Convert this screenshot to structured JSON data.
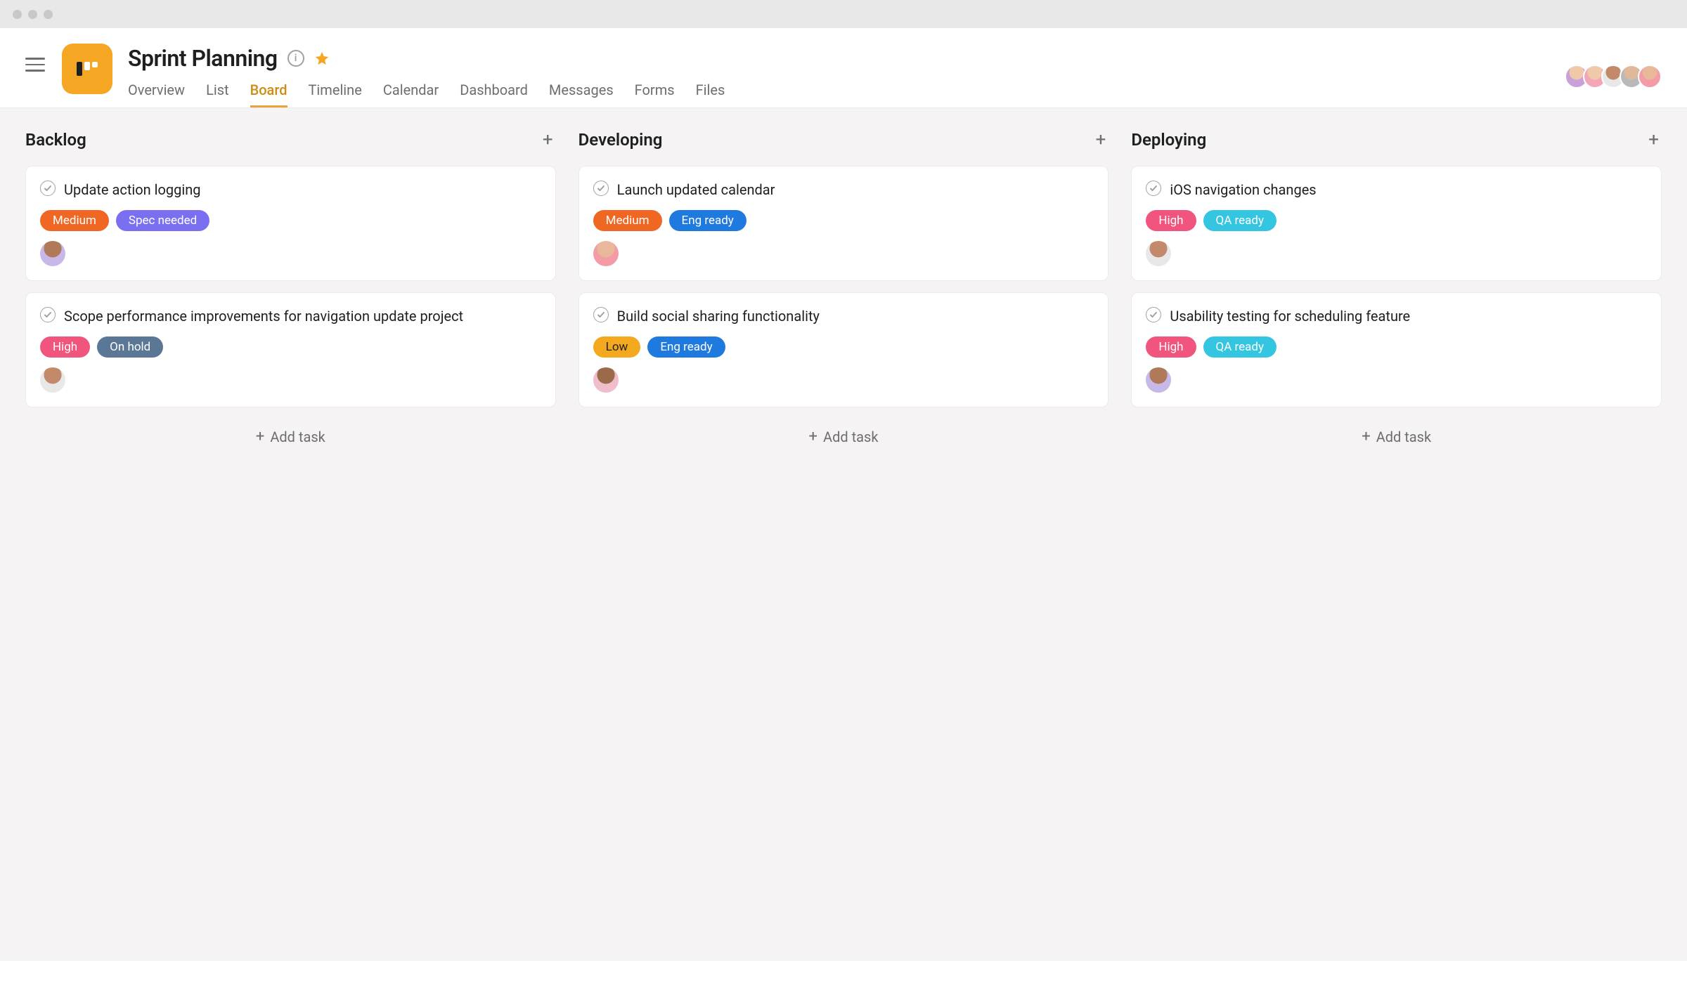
{
  "project": {
    "title": "Sprint Planning",
    "starred": true
  },
  "tabs": [
    {
      "label": "Overview",
      "active": false
    },
    {
      "label": "List",
      "active": false
    },
    {
      "label": "Board",
      "active": true
    },
    {
      "label": "Timeline",
      "active": false
    },
    {
      "label": "Calendar",
      "active": false
    },
    {
      "label": "Dashboard",
      "active": false
    },
    {
      "label": "Messages",
      "active": false
    },
    {
      "label": "Forms",
      "active": false
    },
    {
      "label": "Files",
      "active": false
    }
  ],
  "header_avatars": [
    "av-1",
    "av-5",
    "av-6",
    "av-4",
    "av-2"
  ],
  "tag_colors": {
    "High": "#f1547c",
    "Medium": "#ef6722",
    "Low": "#f4a81d",
    "Spec needed": "#7a6ff0",
    "Eng ready": "#1f7ae0",
    "On hold": "#5a7896",
    "QA ready": "#34c5e0"
  },
  "add_task_label": "Add task",
  "columns": [
    {
      "title": "Backlog",
      "cards": [
        {
          "title": "Update action logging",
          "tags": [
            "Medium",
            "Spec needed"
          ],
          "assignee": "av-7"
        },
        {
          "title": "Scope performance improvements for navigation update project",
          "tags": [
            "High",
            "On hold"
          ],
          "assignee": "av-6"
        }
      ]
    },
    {
      "title": "Developing",
      "cards": [
        {
          "title": "Launch updated calendar",
          "tags": [
            "Medium",
            "Eng ready"
          ],
          "assignee": "av-2"
        },
        {
          "title": "Build social sharing functionality",
          "tags": [
            "Low",
            "Eng ready"
          ],
          "assignee": "av-8"
        }
      ]
    },
    {
      "title": "Deploying",
      "cards": [
        {
          "title": "iOS navigation changes",
          "tags": [
            "High",
            "QA ready"
          ],
          "assignee": "av-6"
        },
        {
          "title": "Usability testing for scheduling feature",
          "tags": [
            "High",
            "QA ready"
          ],
          "assignee": "av-7"
        }
      ]
    }
  ]
}
